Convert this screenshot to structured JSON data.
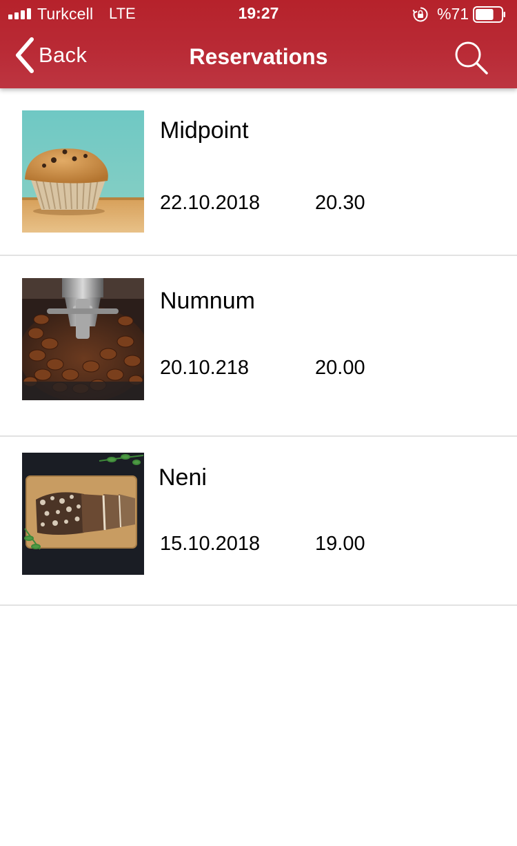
{
  "status_bar": {
    "carrier": "Turkcell",
    "network": "LTE",
    "time": "19:27",
    "battery": "%71",
    "battery_level": 0.71,
    "signal_bars": 4
  },
  "nav": {
    "back_label": "Back",
    "title": "Reservations",
    "search_icon": "search-icon"
  },
  "reservations": [
    {
      "name": "Midpoint",
      "date": "22.10.2018",
      "time": "20.30",
      "image": "muffin-photo"
    },
    {
      "name": "Numnum",
      "date": "20.10.218",
      "time": "20.00",
      "image": "coffee-beans-photo"
    },
    {
      "name": "Neni",
      "date": "15.10.2018",
      "time": "19.00",
      "image": "bread-photo"
    }
  ],
  "colors": {
    "header_red": "#b6222b",
    "divider": "#e2e2e2"
  }
}
